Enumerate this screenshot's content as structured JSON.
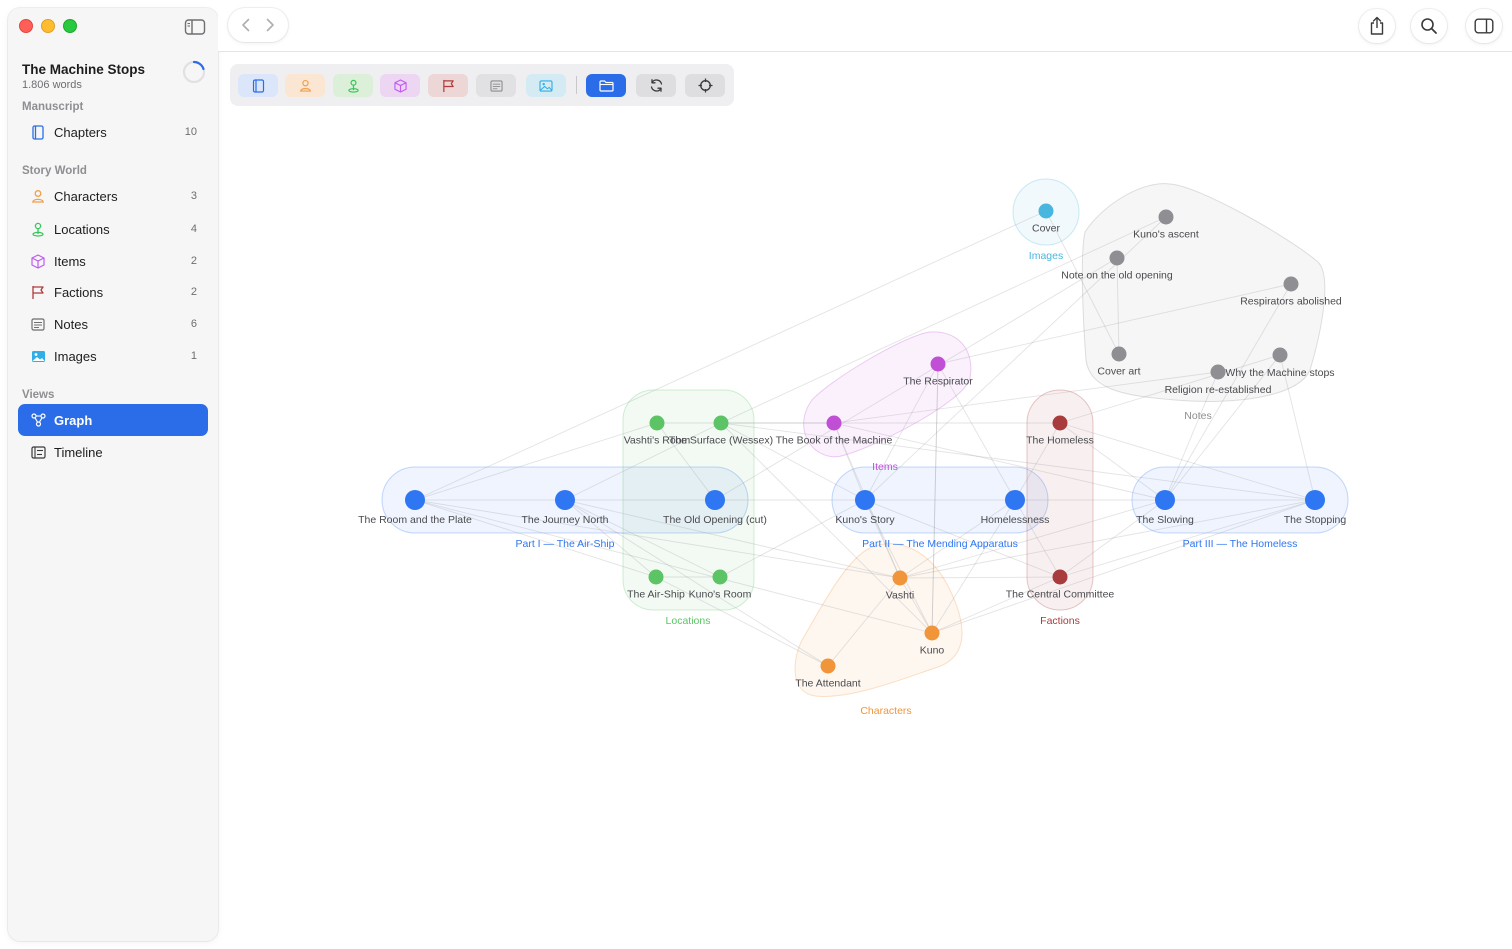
{
  "project": {
    "title": "The Machine Stops",
    "words": "1.806 words"
  },
  "sidebar": {
    "sections": {
      "manuscript": "Manuscript",
      "story_world": "Story World",
      "views": "Views"
    },
    "items": [
      {
        "label": "Chapters",
        "count": "10",
        "icon": "book-icon",
        "color": "#2b6de8"
      },
      {
        "label": "Characters",
        "count": "3",
        "icon": "person-icon",
        "color": "#f0a04b"
      },
      {
        "label": "Locations",
        "count": "4",
        "icon": "pin-icon",
        "color": "#34c759"
      },
      {
        "label": "Items",
        "count": "2",
        "icon": "cube-icon",
        "color": "#bf5af2"
      },
      {
        "label": "Factions",
        "count": "2",
        "icon": "flag-icon",
        "color": "#b03a3a"
      },
      {
        "label": "Notes",
        "count": "6",
        "icon": "note-icon",
        "color": "#8e8e93"
      },
      {
        "label": "Images",
        "count": "1",
        "icon": "image-icon",
        "color": "#32ade6"
      }
    ],
    "views": [
      {
        "label": "Graph",
        "icon": "graph-icon",
        "active": true
      },
      {
        "label": "Timeline",
        "icon": "timeline-icon",
        "active": false
      }
    ]
  },
  "toolbar": {
    "filters": [
      {
        "name": "chapters-filter",
        "icon": "book-icon",
        "color": "#2b6de8",
        "bg": "#dbe6fb"
      },
      {
        "name": "characters-filter",
        "icon": "person-icon",
        "color": "#f0a04b",
        "bg": "#fbe6d4"
      },
      {
        "name": "locations-filter",
        "icon": "pin-icon",
        "color": "#34c759",
        "bg": "#dcefd9"
      },
      {
        "name": "items-filter",
        "icon": "cube-icon",
        "color": "#bf5af2",
        "bg": "#ecd6f1"
      },
      {
        "name": "factions-filter",
        "icon": "flag-icon",
        "color": "#b03a3a",
        "bg": "#ecd6d6"
      },
      {
        "name": "notes-filter",
        "icon": "note-icon",
        "color": "#8e8e93",
        "bg": "#e1e1e3"
      },
      {
        "name": "images-filter",
        "icon": "image-icon",
        "color": "#32ade6",
        "bg": "#d4ebf4"
      }
    ],
    "actions": [
      {
        "name": "group-toggle-button",
        "icon": "folder-icon",
        "active": true
      },
      {
        "name": "relayout-button",
        "icon": "refresh-icon",
        "active": false
      },
      {
        "name": "recenter-button",
        "icon": "crosshair-icon",
        "active": false
      }
    ]
  },
  "colors": {
    "chapter": "#2f76f2",
    "character": "#f0953a",
    "location": "#5cc465",
    "item": "#c14fd6",
    "faction": "#a83b3b",
    "note": "#8e8e93",
    "image": "#48b6de"
  },
  "graph": {
    "groups": [
      {
        "id": "part1",
        "label": "Part I — The Air-Ship",
        "kind": "chapter"
      },
      {
        "id": "part2",
        "label": "Part II — The Mending Apparatus",
        "kind": "chapter"
      },
      {
        "id": "part3",
        "label": "Part III — The Homeless",
        "kind": "chapter"
      },
      {
        "id": "locations",
        "label": "Locations",
        "kind": "location"
      },
      {
        "id": "items",
        "label": "Items",
        "kind": "item"
      },
      {
        "id": "factions",
        "label": "Factions",
        "kind": "faction"
      },
      {
        "id": "characters",
        "label": "Characters",
        "kind": "character"
      },
      {
        "id": "notes",
        "label": "Notes",
        "kind": "note"
      },
      {
        "id": "images",
        "label": "Images",
        "kind": "image"
      }
    ],
    "nodes": [
      {
        "id": "room_plate",
        "label": "The Room and the Plate",
        "kind": "chapter"
      },
      {
        "id": "journey_north",
        "label": "The Journey North",
        "kind": "chapter"
      },
      {
        "id": "old_opening",
        "label": "The Old Opening (cut)",
        "kind": "chapter"
      },
      {
        "id": "kunos_story",
        "label": "Kuno's Story",
        "kind": "chapter"
      },
      {
        "id": "homelessness",
        "label": "Homelessness",
        "kind": "chapter"
      },
      {
        "id": "slowing",
        "label": "The Slowing",
        "kind": "chapter"
      },
      {
        "id": "stopping",
        "label": "The Stopping",
        "kind": "chapter"
      },
      {
        "id": "vashti_room",
        "label": "Vashti's Room",
        "kind": "location"
      },
      {
        "id": "surface",
        "label": "The Surface (Wessex)",
        "kind": "location"
      },
      {
        "id": "airship",
        "label": "The Air-Ship",
        "kind": "location"
      },
      {
        "id": "kunos_room",
        "label": "Kuno's Room",
        "kind": "location"
      },
      {
        "id": "respirator",
        "label": "The Respirator",
        "kind": "item"
      },
      {
        "id": "book_machine",
        "label": "The Book of the Machine",
        "kind": "item"
      },
      {
        "id": "homeless",
        "label": "The Homeless",
        "kind": "faction"
      },
      {
        "id": "central_committee",
        "label": "The Central Committee",
        "kind": "faction"
      },
      {
        "id": "vashti",
        "label": "Vashti",
        "kind": "character"
      },
      {
        "id": "kuno",
        "label": "Kuno",
        "kind": "character"
      },
      {
        "id": "attendant",
        "label": "The Attendant",
        "kind": "character"
      },
      {
        "id": "kunos_ascent",
        "label": "Kuno's ascent",
        "kind": "note"
      },
      {
        "id": "note_old_opening",
        "label": "Note on the old opening",
        "kind": "note"
      },
      {
        "id": "respirators_abolished",
        "label": "Respirators abolished",
        "kind": "note"
      },
      {
        "id": "cover_art",
        "label": "Cover art",
        "kind": "note"
      },
      {
        "id": "religion",
        "label": "Religion re-established",
        "kind": "note"
      },
      {
        "id": "why_machine_stops",
        "label": "Why the Machine stops",
        "kind": "note"
      },
      {
        "id": "cover",
        "label": "Cover",
        "kind": "image"
      }
    ],
    "edges": [
      [
        "room_plate",
        "journey_north"
      ],
      [
        "journey_north",
        "old_opening"
      ],
      [
        "old_opening",
        "kunos_story"
      ],
      [
        "kunos_story",
        "homelessness"
      ],
      [
        "homelessness",
        "slowing"
      ],
      [
        "slowing",
        "stopping"
      ],
      [
        "room_plate",
        "vashti_room"
      ],
      [
        "room_plate",
        "vashti"
      ],
      [
        "room_plate",
        "kuno"
      ],
      [
        "room_plate",
        "airship"
      ],
      [
        "journey_north",
        "airship"
      ],
      [
        "journey_north",
        "vashti"
      ],
      [
        "journey_north",
        "attendant"
      ],
      [
        "journey_north",
        "surface"
      ],
      [
        "journey_north",
        "kunos_room"
      ],
      [
        "old_opening",
        "note_old_opening"
      ],
      [
        "old_opening",
        "vashti_room"
      ],
      [
        "kunos_story",
        "kuno"
      ],
      [
        "kunos_story",
        "vashti"
      ],
      [
        "kunos_story",
        "kunos_room"
      ],
      [
        "kunos_story",
        "surface"
      ],
      [
        "kunos_story",
        "respirator"
      ],
      [
        "kunos_story",
        "book_machine"
      ],
      [
        "kunos_story",
        "kunos_ascent"
      ],
      [
        "kunos_story",
        "central_committee"
      ],
      [
        "homelessness",
        "homeless"
      ],
      [
        "homelessness",
        "central_committee"
      ],
      [
        "homelessness",
        "kuno"
      ],
      [
        "homelessness",
        "vashti"
      ],
      [
        "homelessness",
        "respirator"
      ],
      [
        "slowing",
        "religion"
      ],
      [
        "slowing",
        "respirators_abolished"
      ],
      [
        "slowing",
        "why_machine_stops"
      ],
      [
        "slowing",
        "vashti"
      ],
      [
        "slowing",
        "central_committee"
      ],
      [
        "slowing",
        "book_machine"
      ],
      [
        "slowing",
        "homeless"
      ],
      [
        "stopping",
        "why_machine_stops"
      ],
      [
        "stopping",
        "kuno"
      ],
      [
        "stopping",
        "vashti"
      ],
      [
        "stopping",
        "homeless"
      ],
      [
        "stopping",
        "central_committee"
      ],
      [
        "stopping",
        "surface"
      ],
      [
        "cover",
        "cover_art"
      ],
      [
        "cover",
        "room_plate"
      ],
      [
        "respirator",
        "respirators_abolished"
      ],
      [
        "respirator",
        "kuno"
      ],
      [
        "book_machine",
        "vashti"
      ],
      [
        "book_machine",
        "vashti_room"
      ],
      [
        "homeless",
        "surface"
      ],
      [
        "homeless",
        "why_machine_stops"
      ],
      [
        "vashti",
        "kuno"
      ],
      [
        "vashti",
        "attendant"
      ],
      [
        "vashti",
        "central_committee"
      ],
      [
        "kuno",
        "central_committee"
      ],
      [
        "kuno",
        "surface"
      ],
      [
        "kuno",
        "respirator"
      ],
      [
        "attendant",
        "airship"
      ],
      [
        "airship",
        "kunos_room"
      ],
      [
        "religion",
        "book_machine"
      ],
      [
        "kunos_ascent",
        "surface"
      ],
      [
        "note_old_opening",
        "cover_art"
      ]
    ]
  }
}
